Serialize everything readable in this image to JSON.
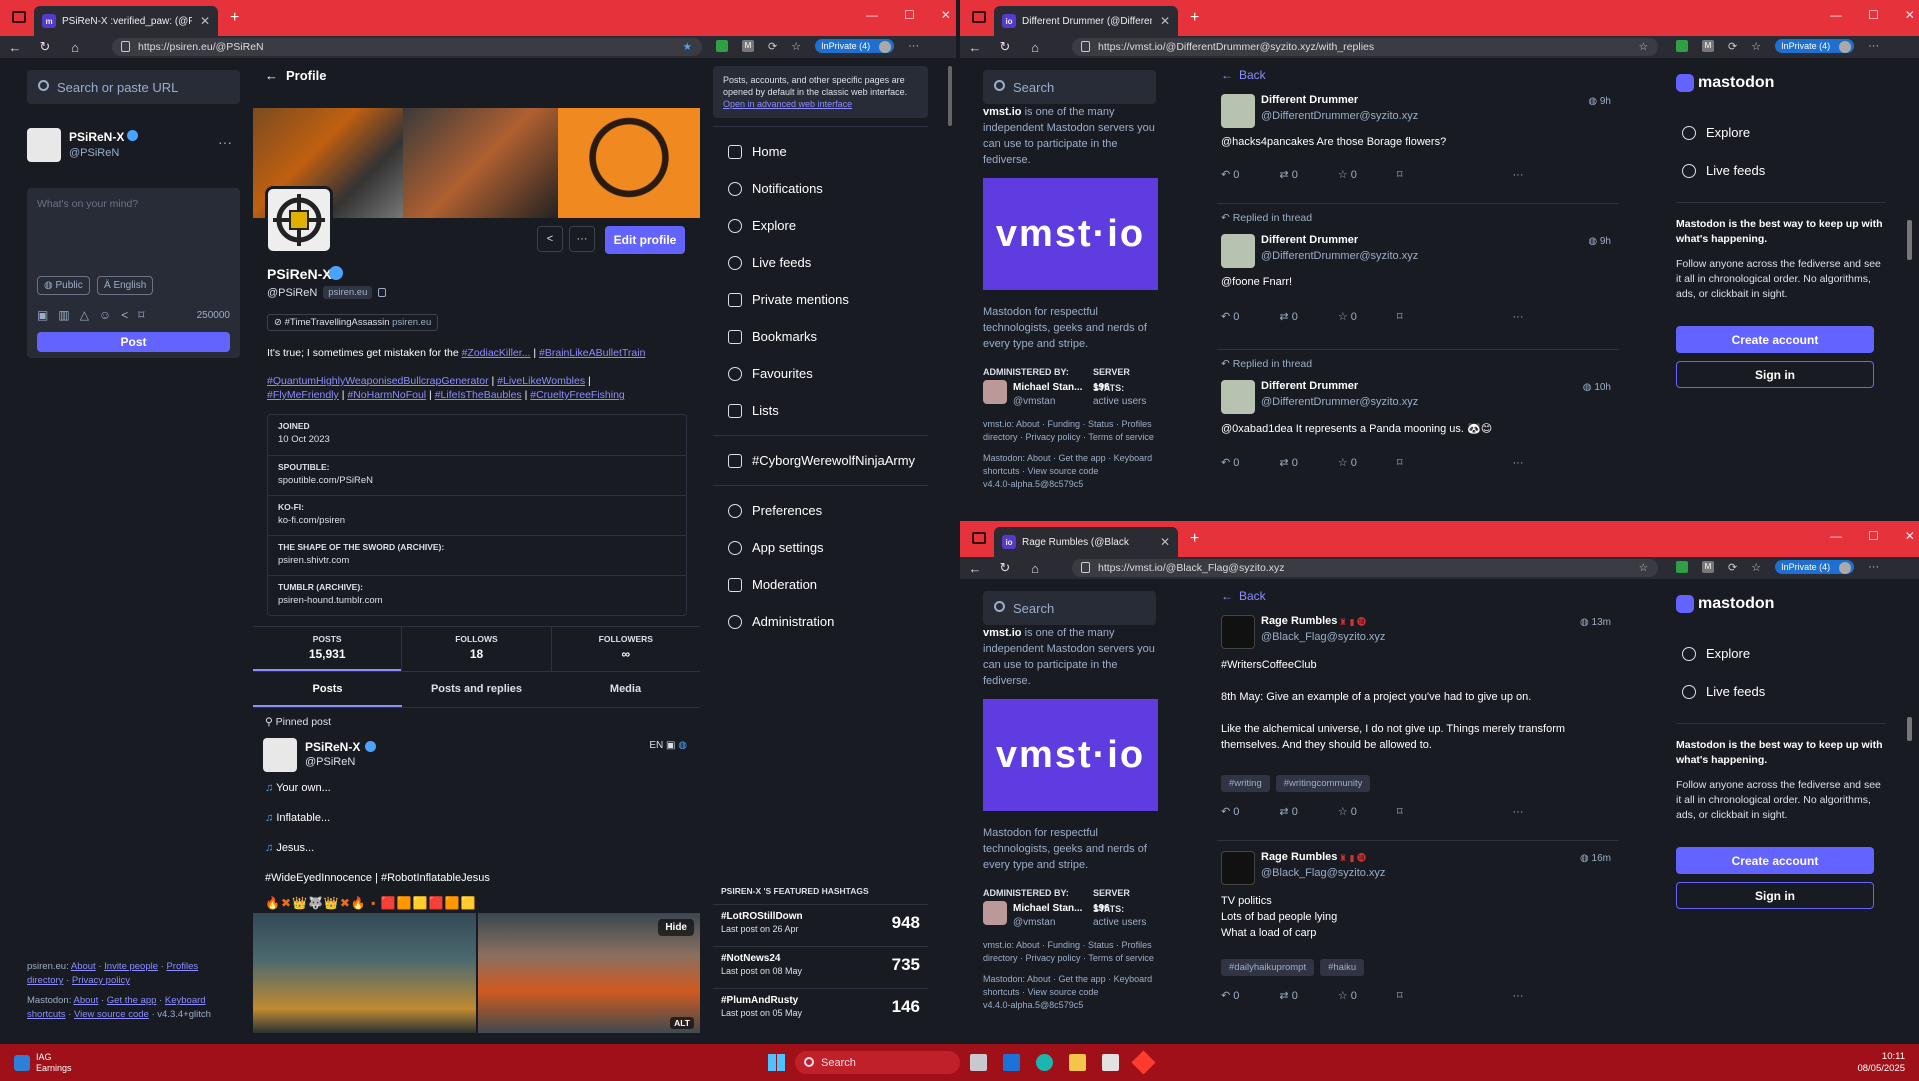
{
  "w1": {
    "tab_title": "PSiReN-X :verified_paw: (@PSiReN",
    "url": "https://psiren.eu/@PSiReN",
    "inprivate": "InPrivate (4)",
    "search_placeholder": "Search or paste URL",
    "me": {
      "name": "PSiReN-X",
      "handle": "@PSiReN"
    },
    "compose": {
      "placeholder": "What's on your mind?",
      "visibility": "Public",
      "language": "English",
      "char_count": "250000",
      "post_label": "Post"
    },
    "footer1": [
      "psiren.eu:",
      "About",
      "Invite people",
      "Profiles directory",
      "Privacy policy"
    ],
    "footer2": [
      "Mastodon:",
      "About",
      "Get the app",
      "Keyboard shortcuts",
      "View source code",
      "v4.3.4+glitch"
    ],
    "profile": {
      "back_label": "Profile",
      "edit_label": "Edit profile",
      "name": "PSiReN-X",
      "handle": "@PSiReN",
      "domain": "psiren.eu",
      "tag_badge": "#TimeTravellingAssassin",
      "tag_badge_domain": "psiren.eu",
      "bio_line1_text": "It's true; I sometimes get mistaken for the ",
      "bio_line1_tag1": "#ZodiacKiller...",
      "bio_line1_sep": " | ",
      "bio_line1_tag2": "#BrainLikeABulletTrain",
      "bio_tags2": [
        "#QuantumHighlyWeaponisedBullcrapGenerator",
        "#LiveLikeWombles"
      ],
      "bio_tags3": [
        "#FlyMeFriendly",
        "#NoHarmNoFoul",
        "#LifeIsTheBaubles",
        "#CrueltyFreeFishing"
      ],
      "fields": [
        {
          "label": "JOINED",
          "value": "10 Oct 2023"
        },
        {
          "label": "SPOUTIBLE:",
          "value": "spoutible.com/PSiReN"
        },
        {
          "label": "KO-FI:",
          "value": "ko-fi.com/psiren"
        },
        {
          "label": "THE SHAPE OF THE SWORD (ARCHIVE):",
          "value": "psiren.shivtr.com"
        },
        {
          "label": "TUMBLR (ARCHIVE):",
          "value": "psiren-hound.tumblr.com"
        }
      ],
      "stats": [
        {
          "label": "POSTS",
          "value": "15,931"
        },
        {
          "label": "FOLLOWS",
          "value": "18"
        },
        {
          "label": "FOLLOWERS",
          "value": "∞"
        }
      ],
      "tabs": [
        "Posts",
        "Posts and replies",
        "Media"
      ],
      "pinned_label": "Pinned post",
      "post": {
        "name": "PSiReN-X",
        "handle": "@PSiReN",
        "lang": "EN",
        "lines": [
          "Your own...",
          "Inflatable...",
          "Jesus..."
        ],
        "tags": "#WideEyedInnocence | #RobotInflatableJesus",
        "hide": "Hide",
        "alt": "ALT"
      }
    },
    "notice": {
      "text": "Posts, accounts, and other specific pages are opened by default in the classic web interface.",
      "link": "Open in advanced web interface"
    },
    "nav": [
      "Home",
      "Notifications",
      "Explore",
      "Live feeds",
      "Private mentions",
      "Bookmarks",
      "Favourites",
      "Lists"
    ],
    "nav_tag": "#CyborgWerewolfNinjaArmy",
    "nav2": [
      "Preferences",
      "App settings",
      "Moderation",
      "Administration"
    ],
    "featured_title": "PSIREN-X 'S FEATURED HASHTAGS",
    "featured": [
      {
        "tag": "#LotROStillDown",
        "sub": "Last post on 26 Apr",
        "count": "948"
      },
      {
        "tag": "#NotNews24",
        "sub": "Last post on 08 May",
        "count": "735"
      },
      {
        "tag": "#PlumAndRusty",
        "sub": "Last post on 05 May",
        "count": "146"
      }
    ]
  },
  "w2": {
    "tab_title": "Different Drummer (@DifferentD",
    "url": "https://vmst.io/@DifferentDrummer@syzito.xyz/with_replies",
    "inprivate": "InPrivate (4)",
    "search": "Search",
    "about": {
      "intro_strong": "vmst.io",
      "intro_rest": " is one of the many independent Mastodon servers you can use to participate in the fediverse.",
      "logo": "vmst·io",
      "desc": "Mastodon for respectful technologists, geeks and nerds of every type and stripe.",
      "admin_label": "ADMINISTERED BY:",
      "stats_label": "SERVER STATS:",
      "admin_name": "Michael Stan...",
      "admin_handle": "@vmstan",
      "users": "196",
      "users_label": "active users",
      "links1": "vmst.io: About · Funding · Status · Profiles directory · Privacy policy · Terms of service",
      "links2": "Mastodon: About · Get the app · Keyboard shortcuts · View source code",
      "version": "v4.4.0-alpha.5@8c579c5"
    },
    "back": "Back",
    "posts": [
      {
        "replied": "",
        "name": "Different Drummer",
        "handle": "@DifferentDrummer@syzito.xyz",
        "time": "9h",
        "text": "@hacks4pancakes Are those Borage flowers?"
      },
      {
        "replied": "Replied in thread",
        "name": "Different Drummer",
        "handle": "@DifferentDrummer@syzito.xyz",
        "time": "9h",
        "text": "@foone Fnarr!"
      },
      {
        "replied": "Replied in thread",
        "name": "Different Drummer",
        "handle": "@DifferentDrummer@syzito.xyz",
        "time": "10h",
        "text": "@0xabad1dea It represents a Panda mooning us. 🐼😊"
      }
    ],
    "counts": [
      "0",
      "0",
      "0"
    ],
    "side": {
      "logo": "mastodon",
      "explore": "Explore",
      "live": "Live feeds",
      "pitch_bold": "Mastodon is the best way to keep up with what's happening.",
      "pitch": "Follow anyone across the fediverse and see it all in chronological order. No algorithms, ads, or clickbait in sight.",
      "create": "Create account",
      "signin": "Sign in"
    }
  },
  "w3": {
    "tab_title": "Rage Rumbles (@Black",
    "url": "https://vmst.io/@Black_Flag@syzito.xyz",
    "inprivate": "InPrivate (4)",
    "back": "Back",
    "posts": [
      {
        "name": "Rage Rumbles",
        "handle": "@Black_Flag@syzito.xyz",
        "time": "13m",
        "lines": [
          "#WritersCoffeeClub",
          "8th May: Give an example of a project you've had to give up on.",
          "Like the alchemical universe, I do not give up. Things merely transform themselves. And they should be allowed to."
        ],
        "chips": [
          "#writing",
          "#writingcommunity"
        ]
      },
      {
        "name": "Rage Rumbles",
        "handle": "@Black_Flag@syzito.xyz",
        "time": "16m",
        "lines": [
          "TV politics",
          "Lots of bad people lying",
          "What a load of carp"
        ],
        "chips": [
          "#dailyhaikuprompt",
          "#haiku"
        ]
      }
    ]
  },
  "taskbar": {
    "app": "IAG",
    "app_sub": "Earnings",
    "search": "Search",
    "time": "10:11",
    "date": "08/05/2025"
  }
}
